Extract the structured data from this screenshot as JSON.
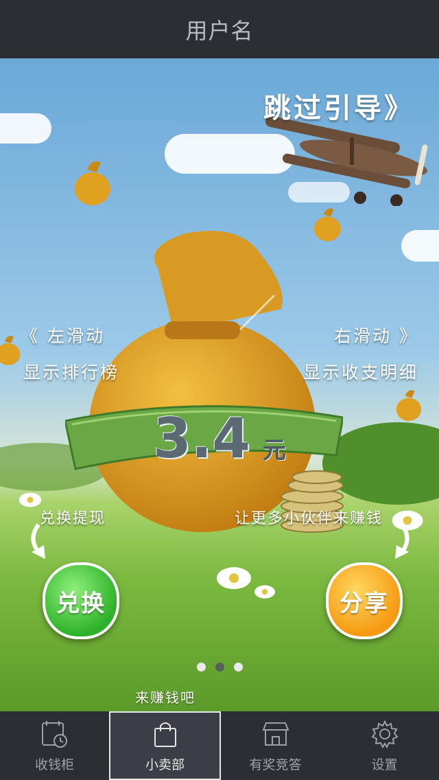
{
  "header": {
    "title": "用户名"
  },
  "guide": {
    "skip_label": "跳过引导》",
    "left_hint_line1": "《 左滑动",
    "left_hint_line2": "显示排行榜",
    "right_hint_line1": "右滑动 》",
    "right_hint_line2": "显示收支明细"
  },
  "balance": {
    "amount": "3.4",
    "unit": "元"
  },
  "actions": {
    "exchange_caption": "兑换提现",
    "exchange_button": "兑换",
    "share_caption": "让更多小伙伴来赚钱",
    "share_button": "分享"
  },
  "pager": {
    "count": 3,
    "active_index": 1
  },
  "tooltip": {
    "text": "来赚钱吧"
  },
  "tabbar": {
    "items": [
      {
        "label": "收钱柜",
        "icon": "calendar-clock-icon",
        "active": false
      },
      {
        "label": "小卖部",
        "icon": "shopping-bag-icon",
        "active": true
      },
      {
        "label": "有奖竞答",
        "icon": "storefront-icon",
        "active": false
      },
      {
        "label": "设置",
        "icon": "gear-icon",
        "active": false
      }
    ]
  },
  "colors": {
    "header_bg": "#2b2e33",
    "exchange_green": "#2fb22b",
    "share_orange": "#f59a12",
    "banner_green": "#6aa846"
  }
}
